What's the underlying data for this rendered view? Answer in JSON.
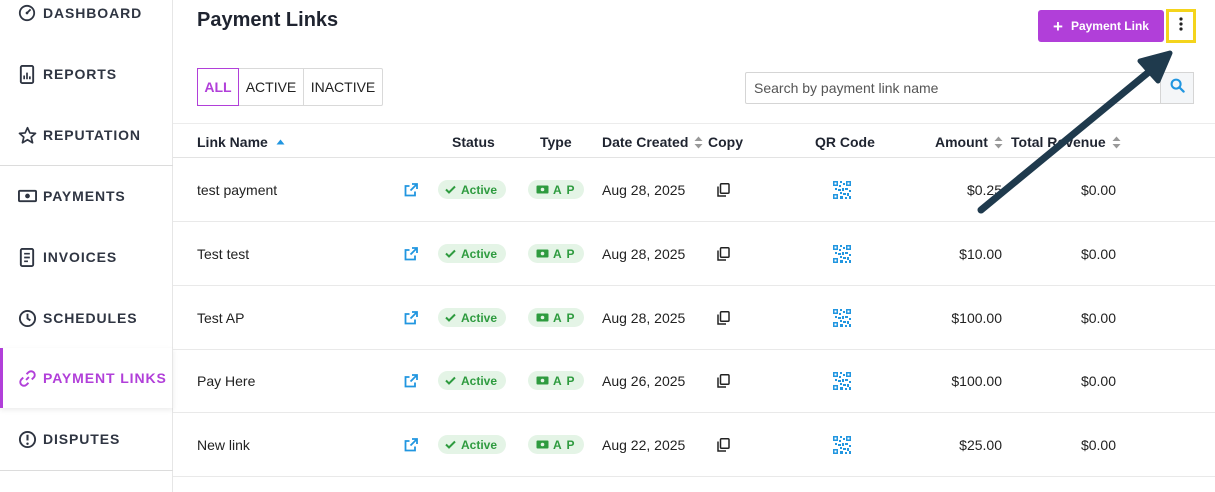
{
  "sidebar": {
    "items": [
      {
        "label": "DASHBOARD",
        "icon": "dashboard-icon",
        "active": false
      },
      {
        "label": "REPORTS",
        "icon": "reports-icon",
        "active": false
      },
      {
        "label": "REPUTATION",
        "icon": "star-icon",
        "active": false
      },
      {
        "label": "PAYMENTS",
        "icon": "cash-icon",
        "active": false
      },
      {
        "label": "INVOICES",
        "icon": "invoice-icon",
        "active": false
      },
      {
        "label": "SCHEDULES",
        "icon": "clock-icon",
        "active": false
      },
      {
        "label": "PAYMENT LINKS",
        "icon": "link-icon",
        "active": true
      },
      {
        "label": "DISPUTES",
        "icon": "alert-icon",
        "active": false
      }
    ]
  },
  "header": {
    "title": "Payment Links",
    "add_button": "Payment Link",
    "more_icon": "vertical-dots-icon"
  },
  "filters": [
    "ALL",
    "ACTIVE",
    "INACTIVE"
  ],
  "active_filter": "ALL",
  "search": {
    "placeholder": "Search by payment link name",
    "value": ""
  },
  "table": {
    "columns": {
      "name": "Link Name",
      "status": "Status",
      "type": "Type",
      "date": "Date Created",
      "copy": "Copy",
      "qr": "QR Code",
      "amount": "Amount",
      "revenue": "Total Revenue"
    },
    "rows": [
      {
        "name": "test payment",
        "status": "Active",
        "type": "A P",
        "date": "Aug 28, 2025",
        "amount": "$0.25",
        "revenue": "$0.00"
      },
      {
        "name": "Test test",
        "status": "Active",
        "type": "A P",
        "date": "Aug 28, 2025",
        "amount": "$10.00",
        "revenue": "$0.00"
      },
      {
        "name": "Test AP",
        "status": "Active",
        "type": "A P",
        "date": "Aug 28, 2025",
        "amount": "$100.00",
        "revenue": "$0.00"
      },
      {
        "name": "Pay Here",
        "status": "Active",
        "type": "A P",
        "date": "Aug 26, 2025",
        "amount": "$100.00",
        "revenue": "$0.00"
      },
      {
        "name": "New link",
        "status": "Active",
        "type": "A P",
        "date": "Aug 22, 2025",
        "amount": "$25.00",
        "revenue": "$0.00"
      }
    ]
  },
  "colors": {
    "accent": "#b13fd9",
    "highlight": "#f4d41c",
    "arrow": "#1f3a4d",
    "link_blue": "#2196e0",
    "active_green": "#2e9b3f"
  }
}
